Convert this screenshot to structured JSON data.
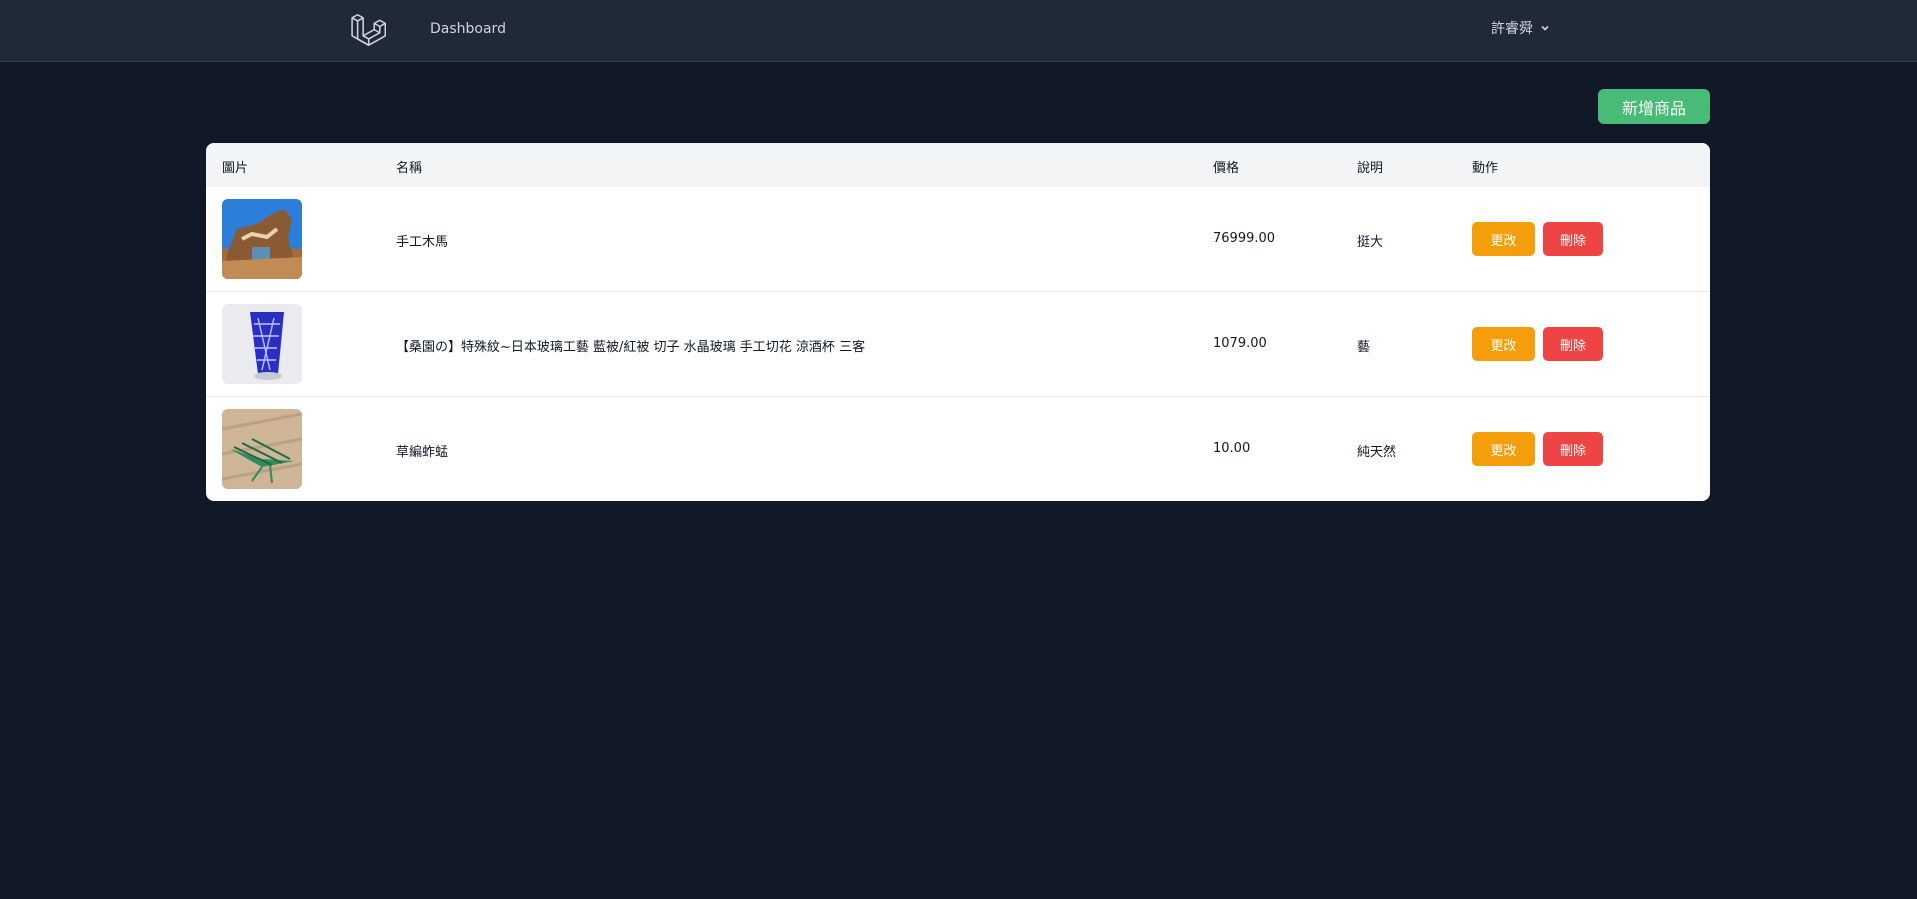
{
  "nav": {
    "dashboard_label": "Dashboard",
    "user_name": "許睿舜"
  },
  "toolbar": {
    "add_label": "新增商品"
  },
  "table": {
    "headers": {
      "image": "圖片",
      "name": "名稱",
      "price": "價格",
      "desc": "說明",
      "action": "動作"
    },
    "rows": [
      {
        "name": "手工木馬",
        "price": "76999.00",
        "desc": "挺大",
        "edit_label": "更改",
        "delete_label": "刪除",
        "image_icon": "wooden-horse-photo"
      },
      {
        "name": "【桑園の】特殊紋~日本玻璃工藝 藍被/紅被 切子 水晶玻璃 手工切花 涼酒杯 三客",
        "price": "1079.00",
        "desc": "藝",
        "edit_label": "更改",
        "delete_label": "刪除",
        "image_icon": "blue-glass-photo"
      },
      {
        "name": "草編蚱蜢",
        "price": "10.00",
        "desc": "純天然",
        "edit_label": "更改",
        "delete_label": "刪除",
        "image_icon": "grass-grasshopper-photo"
      }
    ]
  },
  "colors": {
    "background": "#111827",
    "navbar": "#1f2937",
    "add_button": "#48bb78",
    "edit_button": "#f59e0b",
    "delete_button": "#ef4444"
  }
}
